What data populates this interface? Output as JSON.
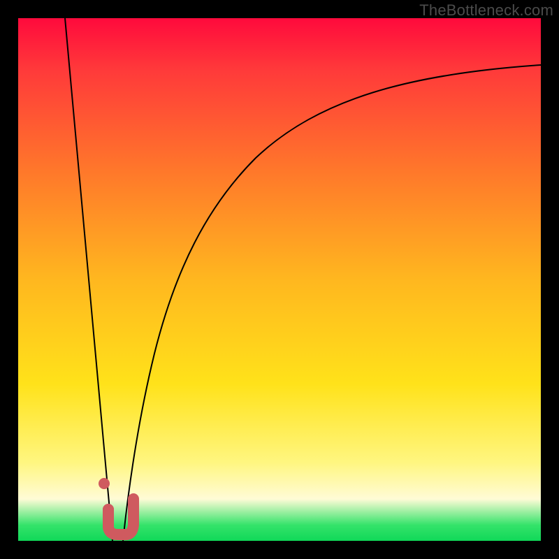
{
  "watermark": "TheBottleneck.com",
  "colors": {
    "frame": "#000000",
    "gradient_top": "#ff0a3c",
    "gradient_bottom": "#10d858",
    "curve": "#000000",
    "marker": "#cf5a5f"
  },
  "chart_data": {
    "type": "line",
    "title": "",
    "xlabel": "",
    "ylabel": "",
    "xlim": [
      0,
      100
    ],
    "ylim": [
      0,
      100
    ],
    "grid": false,
    "legend": false,
    "axes_visible": false,
    "note": "No tick labels or axes are rendered; values are read off relative geometry in percent of plot area (0=left/bottom, 100=right/top).",
    "series": [
      {
        "name": "left-steep-line",
        "style": "line",
        "x": [
          9,
          10,
          11,
          12,
          13,
          14,
          15,
          16,
          17,
          18
        ],
        "y": [
          100,
          89,
          78,
          67,
          56,
          44,
          33,
          22,
          11,
          0
        ]
      },
      {
        "name": "right-saturating-curve",
        "style": "line",
        "x": [
          20,
          22,
          25,
          28,
          32,
          36,
          42,
          50,
          60,
          72,
          85,
          100
        ],
        "y": [
          0,
          14,
          30,
          43,
          55,
          64,
          72,
          79,
          84,
          87,
          89.5,
          91
        ]
      },
      {
        "name": "marker-dots",
        "style": "scatter",
        "x": [
          16.5,
          17.3
        ],
        "y": [
          11,
          6
        ]
      },
      {
        "name": "marker-j-stroke",
        "style": "line",
        "x": [
          17.3,
          17.3,
          18.3,
          20.0,
          21.5,
          22.0
        ],
        "y": [
          6,
          2.5,
          1.2,
          1.2,
          2.5,
          8
        ]
      }
    ]
  }
}
